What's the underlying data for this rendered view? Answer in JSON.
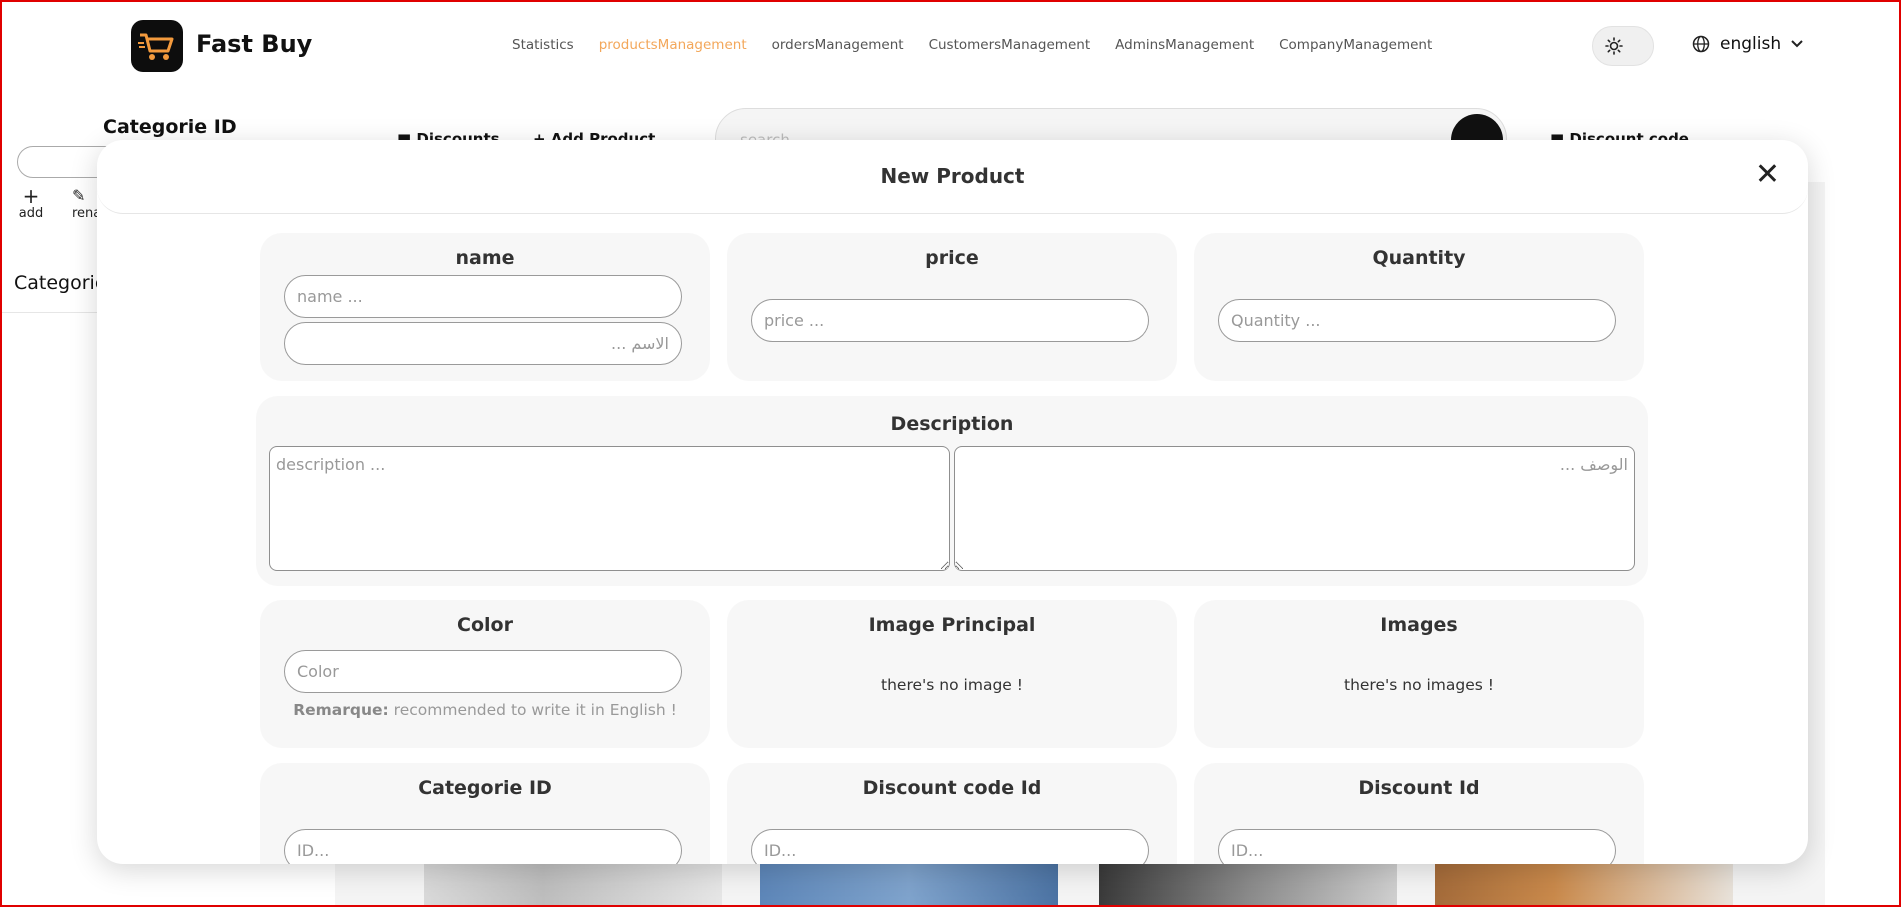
{
  "app": {
    "brand": "Fast Buy",
    "logo_icon": "shopping-cart-icon",
    "accent_color": "#f3a75a"
  },
  "nav": {
    "items": [
      {
        "label": "Statistics",
        "active": false
      },
      {
        "label": "productsManagement",
        "active": true
      },
      {
        "label": "ordersManagement",
        "active": false
      },
      {
        "label": "CustomersManagement",
        "active": false
      },
      {
        "label": "AdminsManagement",
        "active": false
      },
      {
        "label": "CompanyManagement",
        "active": false
      }
    ],
    "language": "english"
  },
  "background": {
    "categorie_title": "Categorie ID",
    "add_label": "add",
    "rename_label": "rena",
    "categories_label": "Categorie",
    "discounts_label": "Discounts",
    "add_product_label": "Add Product",
    "search_placeholder": "search",
    "discount_code_label": "Discount code"
  },
  "modal": {
    "title": "New Product",
    "name": {
      "title": "name",
      "placeholder_en": "name ...",
      "placeholder_ar": "الاسم ..."
    },
    "price": {
      "title": "price",
      "placeholder": "price ..."
    },
    "quantity": {
      "title": "Quantity",
      "placeholder": "Quantity ..."
    },
    "description": {
      "title": "Description",
      "placeholder_en": "description ...",
      "placeholder_ar": "الوصف ..."
    },
    "color": {
      "title": "Color",
      "placeholder": "Color",
      "remark_label": "Remarque:",
      "remark_text": "recommended to write it in English !"
    },
    "image_principal": {
      "title": "Image Principal",
      "empty_text": "there's no image !"
    },
    "images": {
      "title": "Images",
      "empty_text": "there's no images !"
    },
    "categorie_id": {
      "title": "Categorie ID",
      "placeholder": "ID..."
    },
    "discount_code_id": {
      "title": "Discount code Id",
      "placeholder": "ID..."
    },
    "discount_id": {
      "title": "Discount Id",
      "placeholder": "ID..."
    }
  }
}
